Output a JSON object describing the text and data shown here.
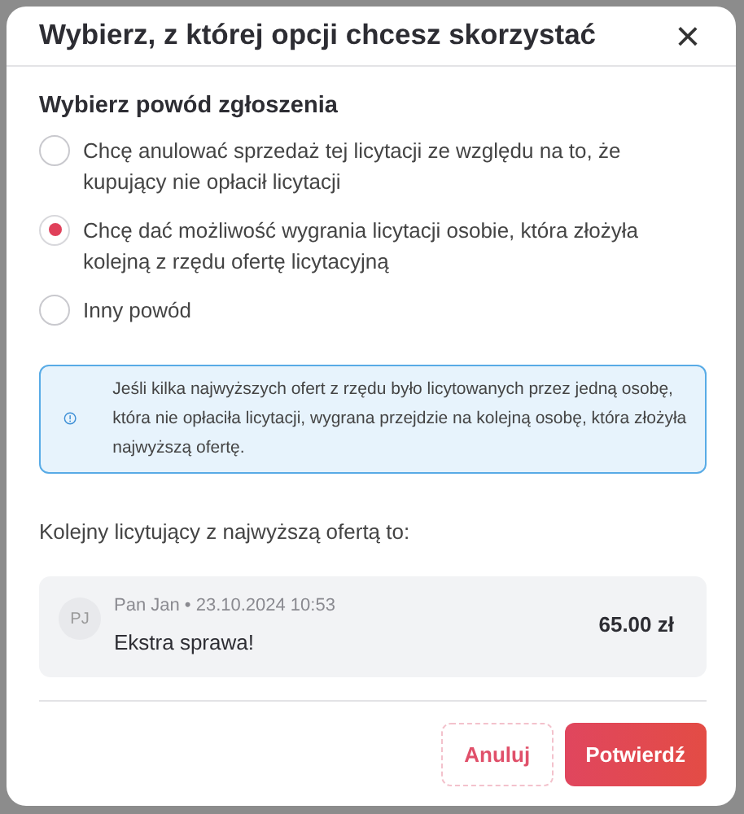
{
  "modal": {
    "title": "Wybierz, z której opcji chcesz skorzystać",
    "close": "×"
  },
  "reason": {
    "heading": "Wybierz powód zgłoszenia",
    "options": [
      {
        "label": "Chcę anulować sprzedaż tej licytacji ze względu na to, że kupujący nie opłacił licytacji",
        "selected": false
      },
      {
        "label": "Chcę dać możliwość wygrania licytacji osobie, która złożyła kolejną z rzędu ofertę licytacyjną",
        "selected": true
      },
      {
        "label": "Inny powód",
        "selected": false
      }
    ]
  },
  "info": {
    "text": "Jeśli kilka najwyższych ofert z rzędu było licytowanych przez jedną osobę, która nie opłaciła licytacji, wygrana przejdzie na kolejną osobę, która złożyła najwyższą ofertę."
  },
  "next_bidder": {
    "label": "Kolejny licytujący z najwyższą ofertą to:",
    "initials": "PJ",
    "meta": "Pan Jan • 23.10.2024 10:53",
    "comment": "Ekstra sprawa!",
    "amount": "65.00 zł"
  },
  "buttons": [
    {
      "label": "Anuluj",
      "kind": "secondary"
    },
    {
      "label": "Potwierdź",
      "kind": "primary"
    }
  ]
}
